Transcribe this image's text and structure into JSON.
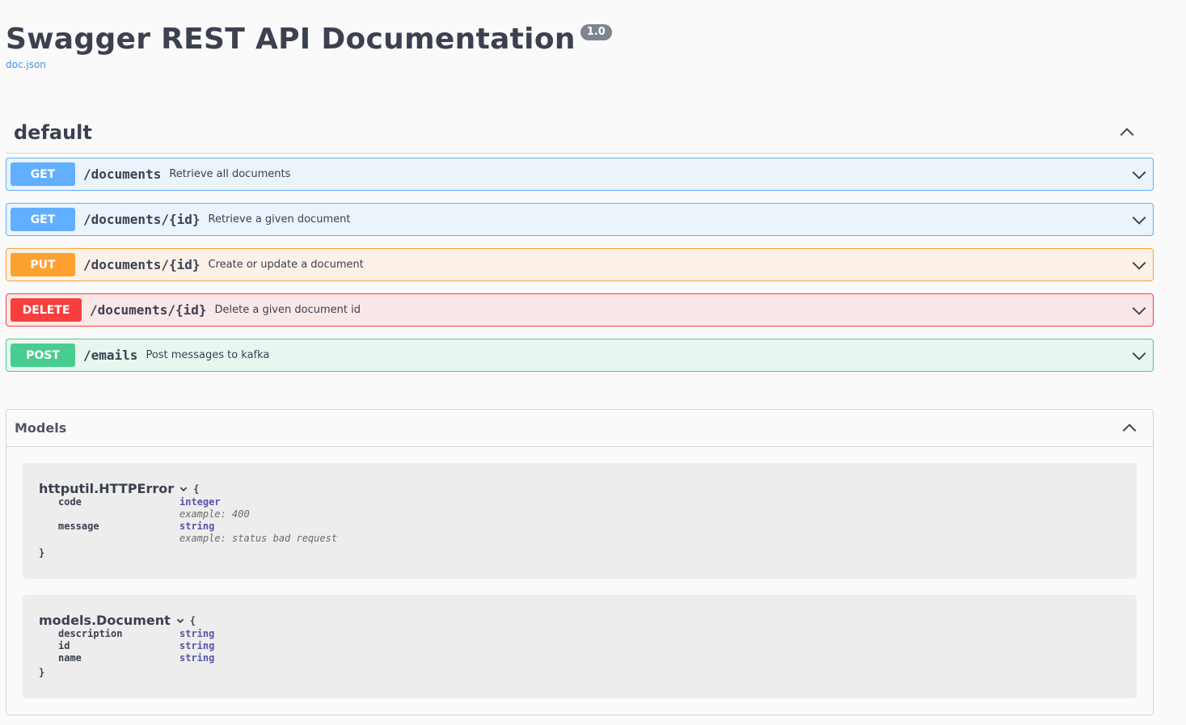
{
  "info": {
    "title": "Swagger REST API Documentation",
    "version": "1.0",
    "doc_link": "doc.json"
  },
  "tag": {
    "name": "default",
    "operations": [
      {
        "method": "GET",
        "path": "/documents",
        "summary": "Retrieve all documents"
      },
      {
        "method": "GET",
        "path": "/documents/{id}",
        "summary": "Retrieve a given document"
      },
      {
        "method": "PUT",
        "path": "/documents/{id}",
        "summary": "Create or update a document"
      },
      {
        "method": "DELETE",
        "path": "/documents/{id}",
        "summary": "Delete a given document id"
      },
      {
        "method": "POST",
        "path": "/emails",
        "summary": "Post messages to kafka"
      }
    ]
  },
  "models": {
    "title": "Models",
    "items": [
      {
        "name": "httputil.HTTPError",
        "open_brace": "{",
        "close_brace": "}",
        "properties": [
          {
            "name": "code",
            "type": "integer",
            "example": "example: 400"
          },
          {
            "name": "message",
            "type": "string",
            "example": "example: status bad request"
          }
        ]
      },
      {
        "name": "models.Document",
        "open_brace": "{",
        "close_brace": "}",
        "properties": [
          {
            "name": "description",
            "type": "string"
          },
          {
            "name": "id",
            "type": "string"
          },
          {
            "name": "name",
            "type": "string"
          }
        ]
      }
    ]
  },
  "colors": {
    "get": "#61affe",
    "put": "#fca130",
    "delete": "#f93e3e",
    "post": "#49cc90",
    "text": "#3b4151",
    "link": "#4990e2"
  },
  "icons": {
    "collapse": "chevron-up-icon",
    "expand": "chevron-down-icon"
  }
}
